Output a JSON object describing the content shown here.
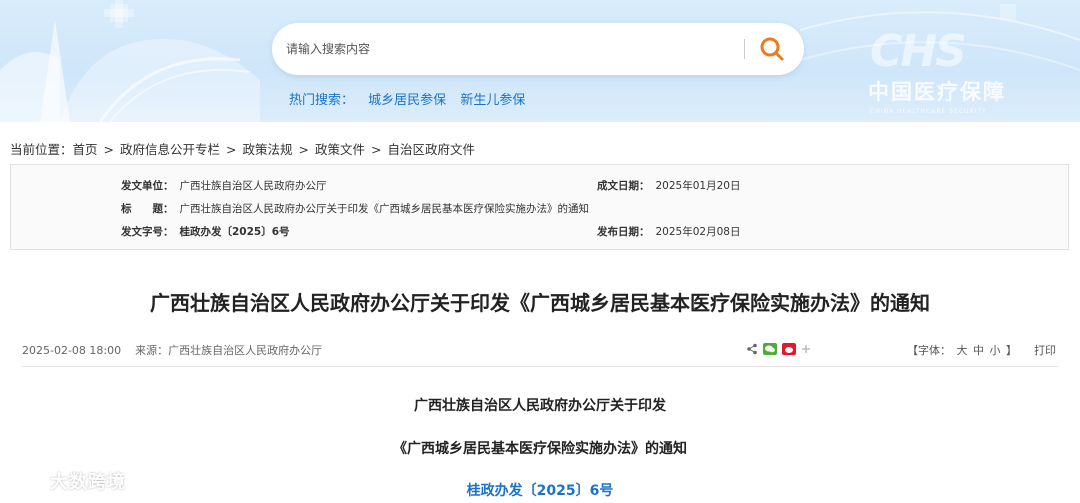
{
  "search": {
    "placeholder": "请输入搜索内容"
  },
  "hot": {
    "label": "热门搜索：",
    "items": [
      "城乡居民参保",
      "新生儿参保"
    ]
  },
  "logo": {
    "mark": "CHS",
    "text": "中国医疗保障",
    "sub": "CHINA HEALTHCARE SECURITY"
  },
  "breadcrumb": {
    "prefix": "当前位置：",
    "items": [
      "首页",
      "政府信息公开专栏",
      "政策法规",
      "政策文件",
      "自治区政府文件"
    ],
    "separator": ">"
  },
  "info": {
    "issuer_label": "发文单位：",
    "issuer": "广西壮族自治区人民政府办公厅",
    "date_label": "成文日期：",
    "date": "2025年01月20日",
    "title_label": "标　　题：",
    "title": "广西壮族自治区人民政府办公厅关于印发《广西城乡居民基本医疗保险实施办法》的通知",
    "docno_label": "发文字号：",
    "docno": "桂政办发〔2025〕6号",
    "pub_label": "发布日期：",
    "pub": "2025年02月08日"
  },
  "article": {
    "title": "广西壮族自治区人民政府办公厅关于印发《广西城乡居民基本医疗保险实施办法》的通知",
    "datetime": "2025-02-08 18:00",
    "source_label": "来源：",
    "source": "广西壮族自治区人民政府办公厅",
    "font_label_open": "【字体：",
    "font_large": "大",
    "font_medium": "中",
    "font_small": "小",
    "font_label_close": "】",
    "print": "打印",
    "line1": "广西壮族自治区人民政府办公厅关于印发",
    "line2": "《广西城乡居民基本医疗保险实施办法》的通知",
    "line3": "桂政办发〔2025〕6号"
  },
  "watermark": {
    "text": "大数跨境"
  },
  "colors": {
    "accent": "#1a73c9",
    "search_icon": "#f0781e",
    "banner": "#d8ecfb"
  }
}
